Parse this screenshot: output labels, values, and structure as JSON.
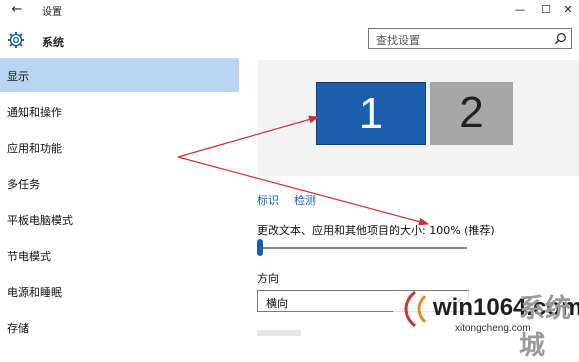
{
  "window": {
    "title": "设置",
    "back_glyph": "←",
    "minimize_glyph": "—",
    "maximize_glyph": "☐",
    "close_glyph": "✕"
  },
  "header": {
    "section_title": "系统",
    "search_placeholder": "查找设置"
  },
  "sidebar": {
    "items": [
      {
        "label": "显示",
        "selected": true
      },
      {
        "label": "通知和操作",
        "selected": false
      },
      {
        "label": "应用和功能",
        "selected": false
      },
      {
        "label": "多任务",
        "selected": false
      },
      {
        "label": "平板电脑模式",
        "selected": false
      },
      {
        "label": "节电模式",
        "selected": false
      },
      {
        "label": "电源和睡眠",
        "selected": false
      },
      {
        "label": "存储",
        "selected": false
      }
    ]
  },
  "display": {
    "monitors": [
      {
        "number": "1",
        "active": true
      },
      {
        "number": "2",
        "active": false
      }
    ],
    "identify_link": "标识",
    "detect_link": "检测",
    "scale_label": "更改文本、应用和其他项目的大小: 100% (推荐)",
    "scale_slider_fraction": 0.0,
    "orientation_label": "方向",
    "orientation_value": "横向"
  },
  "watermark": {
    "text": "win1064.com",
    "cn_text": "系统城",
    "sub": "xitongcheng.com"
  },
  "colors": {
    "accent": "#1b5eac",
    "selected_bg": "#b8d6f2",
    "arrow": "#d03030",
    "link": "#1a5fb4"
  }
}
